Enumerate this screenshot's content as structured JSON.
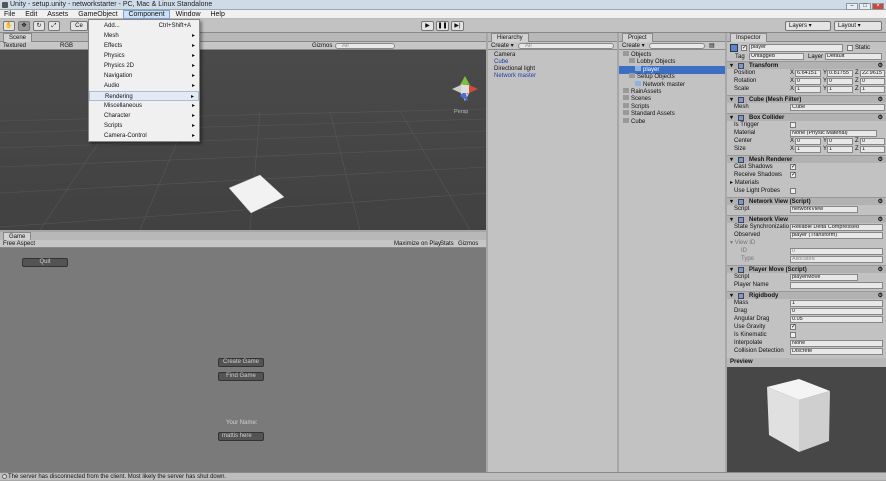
{
  "window": {
    "title": "Unity - setup.unity - networkstarter - PC, Mac & Linux Standalone"
  },
  "menubar": {
    "items": [
      "File",
      "Edit",
      "Assets",
      "GameObject",
      "Component",
      "Window",
      "Help"
    ]
  },
  "toolbar": {
    "pivot": "Ce",
    "layers": "Layers",
    "layout": "Layout"
  },
  "component_menu": {
    "items": [
      {
        "label": "Add...",
        "shortcut": "Ctrl+Shift+A"
      },
      {
        "label": "Mesh",
        "arrow": "▸"
      },
      {
        "label": "Effects",
        "arrow": "▸"
      },
      {
        "label": "Physics",
        "arrow": "▸"
      },
      {
        "label": "Physics 2D",
        "arrow": "▸"
      },
      {
        "label": "Navigation",
        "arrow": "▸"
      },
      {
        "label": "Audio",
        "arrow": "▸"
      },
      {
        "label": "Rendering",
        "arrow": "▸"
      },
      {
        "label": "Miscellaneous",
        "arrow": "▸"
      },
      {
        "label": "Character",
        "arrow": "▸"
      },
      {
        "label": "Scripts",
        "arrow": "▸"
      },
      {
        "label": "Camera-Control",
        "arrow": "▸"
      }
    ],
    "highlighted_index": 7
  },
  "scene": {
    "tab": "Scene",
    "shading": "Textured",
    "render_mode": "RGB",
    "gizmos": "Gizmos",
    "search_placeholder": "All",
    "persp_label": "Persp"
  },
  "game": {
    "tab": "Game",
    "aspect": "Free Aspect",
    "maximize": "Maximize on Play",
    "stats": "Stats",
    "gizmos": "Gizmos",
    "quit_button": "Quit",
    "create_button": "Create Game",
    "find_button": "Find Game",
    "name_label": "Your Name:",
    "name_value": "mattis here"
  },
  "hierarchy": {
    "tab": "Hierarchy",
    "create": "Create",
    "search_placeholder": "All",
    "items": [
      "Camera",
      "Cube",
      "Directional light",
      "Network master"
    ]
  },
  "project": {
    "tab": "Project",
    "create": "Create",
    "tree": [
      {
        "label": "Objects",
        "indent": 0,
        "selected": false
      },
      {
        "label": "Lobby Objects",
        "indent": 1,
        "selected": false
      },
      {
        "label": "player",
        "indent": 2,
        "selected": true
      },
      {
        "label": "Setup Objects",
        "indent": 1,
        "selected": false
      },
      {
        "label": "Network master",
        "indent": 2,
        "selected": false
      },
      {
        "label": "RainAssets",
        "indent": 0,
        "selected": false
      },
      {
        "label": "Scenes",
        "indent": 0,
        "selected": false
      },
      {
        "label": "Scripts",
        "indent": 0,
        "selected": false
      },
      {
        "label": "Standard Assets",
        "indent": 0,
        "selected": false
      },
      {
        "label": "Cube",
        "indent": 0,
        "selected": false
      }
    ]
  },
  "inspector": {
    "tab": "Inspector",
    "object_name": "player",
    "static_label": "Static",
    "tag_label": "Tag",
    "tag_value": "Untagged",
    "layer_label": "Layer",
    "layer_value": "Default",
    "transform": {
      "title": "Transform",
      "position_label": "Position",
      "position": {
        "x": "6.64151",
        "y": "0.81755",
        "z": "22.9615"
      },
      "rotation_label": "Rotation",
      "rotation": {
        "x": "0",
        "y": "0",
        "z": "0"
      },
      "scale_label": "Scale",
      "scale": {
        "x": "1",
        "y": "1",
        "z": "1"
      }
    },
    "mesh_filter": {
      "title": "Cube (Mesh Filter)",
      "mesh_label": "Mesh",
      "mesh_value": "Cube"
    },
    "box_collider": {
      "title": "Box Collider",
      "is_trigger_label": "Is Trigger",
      "material_label": "Material",
      "material_value": "None (Physic Material)",
      "center_label": "Center",
      "center": {
        "x": "0",
        "y": "0",
        "z": "0"
      },
      "size_label": "Size",
      "size": {
        "x": "1",
        "y": "1",
        "z": "1"
      }
    },
    "mesh_renderer": {
      "title": "Mesh Renderer",
      "cast_shadows": "Cast Shadows",
      "receive_shadows": "Receive Shadows",
      "materials": "Materials",
      "use_light_probes": "Use Light Probes"
    },
    "network_view_script": {
      "title": "Network View (Script)",
      "script_label": "Script",
      "script_value": "networkView"
    },
    "network_view": {
      "title": "Network View",
      "state_sync_label": "State Synchronizatio",
      "state_sync_value": "Reliable Delta Compressed",
      "observed_label": "Observed",
      "observed_value": "player (Transform)",
      "view_id_label": "View ID",
      "id_label": "ID",
      "id_value": "0",
      "type_label": "Type",
      "type_value": "Allocated"
    },
    "player_move": {
      "title": "Player Move (Script)",
      "script_label": "Script",
      "script_value": "playerMove",
      "player_name_label": "Player Name"
    },
    "rigidbody": {
      "title": "Rigidbody",
      "mass_label": "Mass",
      "mass": "1",
      "drag_label": "Drag",
      "drag": "0",
      "angular_drag_label": "Angular Drag",
      "angular_drag": "0.05",
      "use_gravity_label": "Use Gravity",
      "is_kinematic_label": "Is Kinematic",
      "interpolate_label": "Interpolate",
      "interpolate": "None",
      "collision_label": "Collision Detection",
      "collision": "Discrete"
    }
  },
  "preview": {
    "label": "Preview"
  },
  "status": {
    "message": "The server has disconnected from the client. Most likely the server has shut down."
  },
  "colors": {
    "selection": "#3d6ec1",
    "scene_bg": "#474747",
    "game_bg": "#7a7a7a",
    "link_blue": "#1f3fa0"
  }
}
